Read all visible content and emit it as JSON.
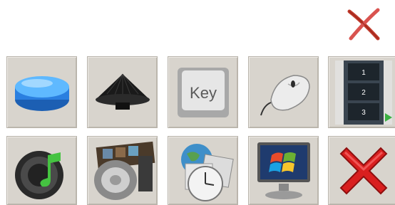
{
  "colors": {
    "tile_background": "#d8d4cd",
    "close_icon_red": "#c0392b"
  },
  "close_button": {
    "icon": "close-x-icon"
  },
  "tiles": [
    {
      "id": "blue-button",
      "icon": "blue-push-button-icon"
    },
    {
      "id": "cone-button",
      "icon": "black-cone-button-icon"
    },
    {
      "id": "keyboard-key",
      "icon": "keyboard-key-icon",
      "label": "Key"
    },
    {
      "id": "mouse",
      "icon": "computer-mouse-icon"
    },
    {
      "id": "filmstrip",
      "icon": "filmstrip-icon",
      "frame_numbers": [
        "1",
        "2",
        "3"
      ]
    },
    {
      "id": "music",
      "icon": "music-speaker-icon"
    },
    {
      "id": "multimedia",
      "icon": "speaker-film-icon"
    },
    {
      "id": "date-time",
      "icon": "globe-clock-calendar-icon"
    },
    {
      "id": "windows",
      "icon": "windows-monitor-icon"
    },
    {
      "id": "cancel",
      "icon": "red-x-icon"
    }
  ]
}
